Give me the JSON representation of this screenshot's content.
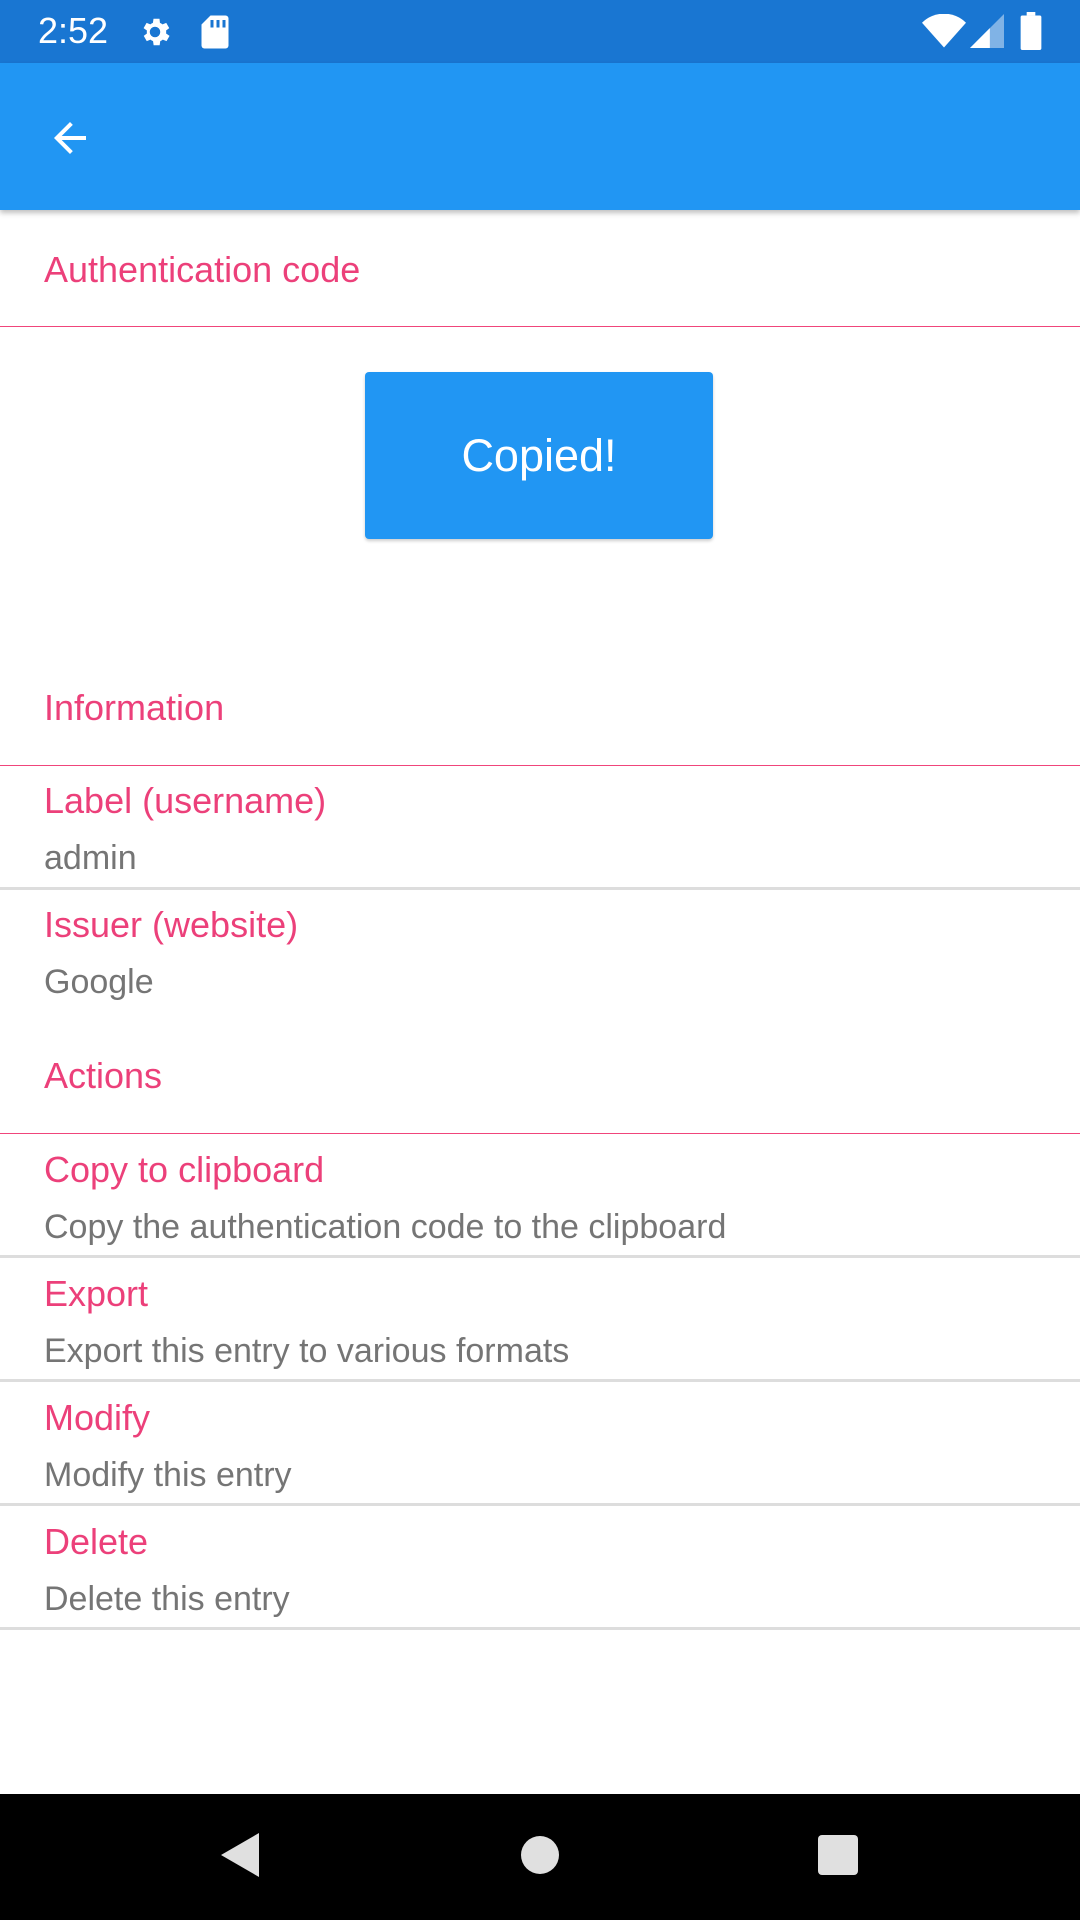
{
  "status_bar": {
    "time": "2:52",
    "icons": [
      "settings-gear-icon",
      "sd-card-icon",
      "wifi-icon",
      "cell-signal-icon",
      "battery-icon"
    ]
  },
  "app_bar": {
    "back_icon": "arrow-back-icon"
  },
  "auth_section": {
    "title": "Authentication code",
    "code_button_label": "Copied!"
  },
  "info_section": {
    "title": "Information",
    "items": [
      {
        "title": "Label (username)",
        "summary": "admin"
      },
      {
        "title": "Issuer (website)",
        "summary": "Google"
      }
    ]
  },
  "actions_section": {
    "title": "Actions",
    "items": [
      {
        "title": "Copy to clipboard",
        "summary": "Copy the authentication code to the clipboard"
      },
      {
        "title": "Export",
        "summary": "Export this entry to various formats"
      },
      {
        "title": "Modify",
        "summary": "Modify this entry"
      },
      {
        "title": "Delete",
        "summary": "Delete this entry"
      }
    ]
  },
  "nav_bar": {
    "buttons": [
      "back-triangle-icon",
      "home-circle-icon",
      "recents-square-icon"
    ]
  },
  "colors": {
    "status_bar": "#1976D2",
    "app_bar": "#2196F3",
    "accent": "#EC407A",
    "summary_text": "#757575",
    "divider": "#DDDDDD"
  }
}
